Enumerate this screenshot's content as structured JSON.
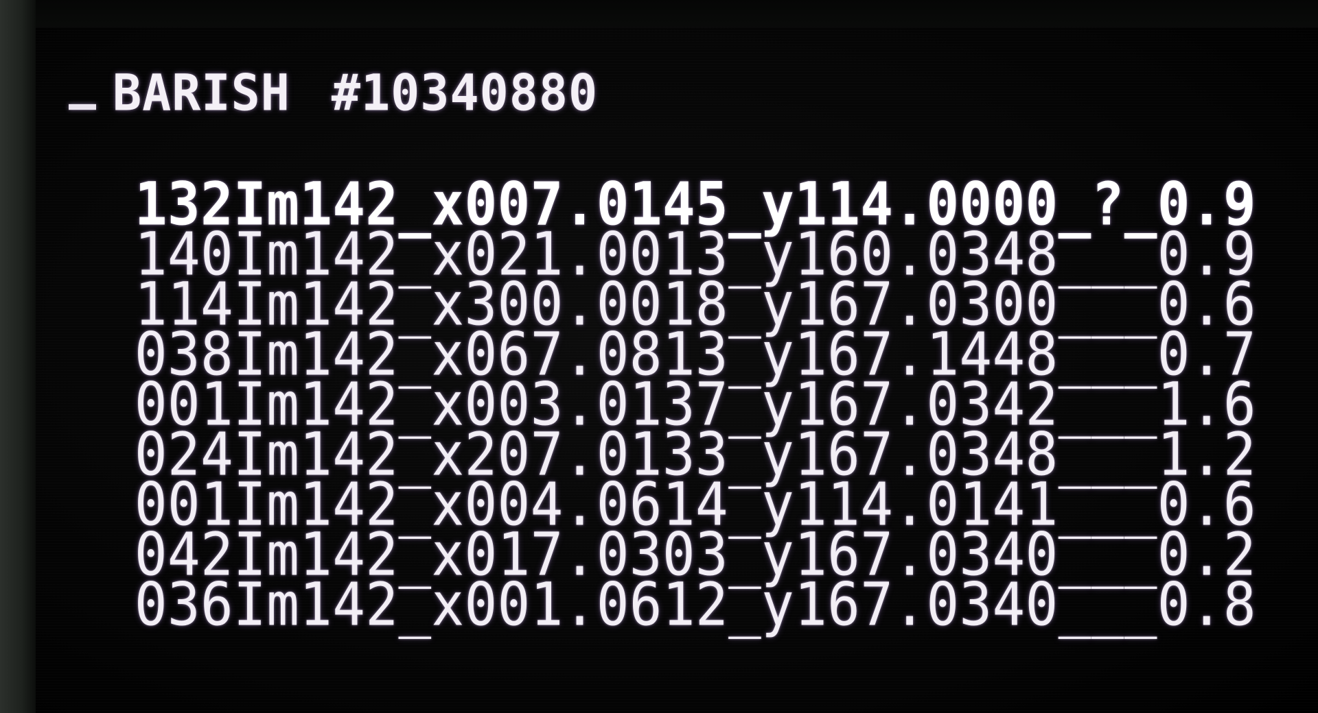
{
  "header": {
    "prompt": "_",
    "name": "BARISH",
    "id": "#10340880"
  },
  "rows": [
    "132Im142_x007.0145_y114.0000_?_0.9",
    "140Im142_x021.0013_y160.0348___0.9",
    "114Im142_x300.0018_y167.0300___0.6",
    "038Im142_x067.0813_y167.1448___0.7",
    "001Im142_x003.0137_y167.0342___1.6",
    "024Im142_x207.0133_y167.0348___1.2",
    "001Im142_x004.0614_y114.0141___0.6",
    "042Im142_x017.0303_y167.0340___0.2",
    "036Im142_x001.0612_y167.0340___0.8"
  ],
  "colors": {
    "screen_bg": "#000000",
    "text": "#f2eef5",
    "glow": "#c8a0ff",
    "bezel": "#1e221e"
  }
}
